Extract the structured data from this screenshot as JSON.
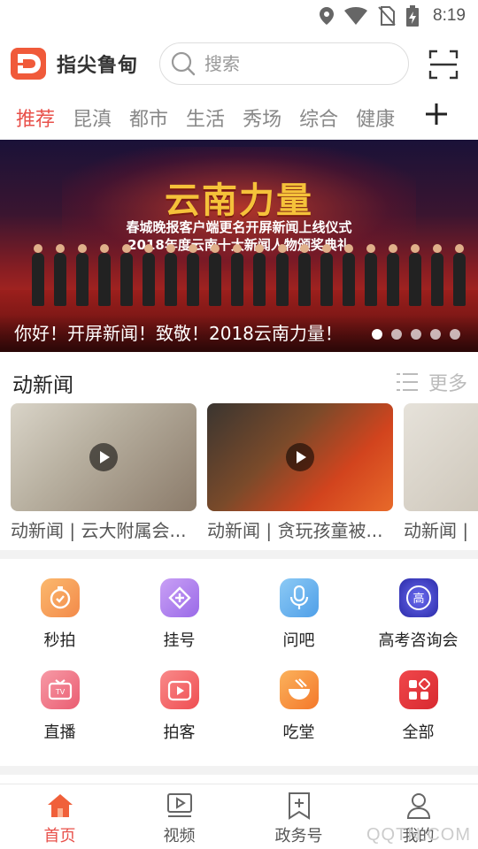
{
  "status_bar": {
    "time": "8:19",
    "icons": [
      "location-icon",
      "wifi-icon",
      "no-sim-icon",
      "battery-charging-icon"
    ]
  },
  "header": {
    "app_title": "指尖鲁甸",
    "logo_icon": "app-logo",
    "search": {
      "placeholder": "搜索",
      "icon": "search-icon"
    },
    "scan_icon": "scan-icon"
  },
  "tabs": {
    "items": [
      {
        "label": "推荐",
        "active": true
      },
      {
        "label": "昆滇",
        "active": false
      },
      {
        "label": "都市",
        "active": false
      },
      {
        "label": "生活",
        "active": false
      },
      {
        "label": "秀场",
        "active": false
      },
      {
        "label": "综合",
        "active": false
      },
      {
        "label": "健康",
        "active": false
      }
    ],
    "add_icon": "plus-icon"
  },
  "banner": {
    "headline": "云南力量",
    "sub_line_1": "春城晚报客户端更名开屏新闻上线仪式",
    "sub_line_2": "2018年度云南十大新闻人物颁奖典礼",
    "caption": "你好！开屏新闻！致敬！2018云南力量！",
    "slide_count": 5,
    "active_slide": 1
  },
  "video_section": {
    "title": "动新闻",
    "more_label": "更多",
    "more_icon": "list-icon",
    "items": [
      {
        "title": "动新闻 | 云大附属会..."
      },
      {
        "title": "动新闻 | 贪玩孩童被..."
      },
      {
        "title": "动新闻 | "
      }
    ]
  },
  "services": {
    "items": [
      {
        "label": "秒拍",
        "icon": "stopwatch-icon",
        "color": "#f5a15c"
      },
      {
        "label": "挂号",
        "icon": "register-plus-icon",
        "color": "#b98af0"
      },
      {
        "label": "问吧",
        "icon": "microphone-icon",
        "color": "#6fb6f0"
      },
      {
        "label": "高考咨询会",
        "icon": "gaokao-icon",
        "color": "#4a4ad0"
      },
      {
        "label": "直播",
        "icon": "tv-icon",
        "color": "#f27a8a"
      },
      {
        "label": "拍客",
        "icon": "video-clip-icon",
        "color": "#f46a6a"
      },
      {
        "label": "吃堂",
        "icon": "bowl-icon",
        "color": "#f59a45"
      },
      {
        "label": "全部",
        "icon": "all-apps-icon",
        "color": "#e8353a"
      }
    ]
  },
  "bottom_nav": {
    "items": [
      {
        "label": "首页",
        "icon": "home-icon",
        "active": true
      },
      {
        "label": "视频",
        "icon": "video-icon",
        "active": false
      },
      {
        "label": "政务号",
        "icon": "bookmark-plus-icon",
        "active": false
      },
      {
        "label": "我的",
        "icon": "profile-icon",
        "active": false
      }
    ]
  },
  "watermark": "QQTN.COM",
  "colors": {
    "accent": "#e8504a",
    "gold": "#f5c23a"
  }
}
